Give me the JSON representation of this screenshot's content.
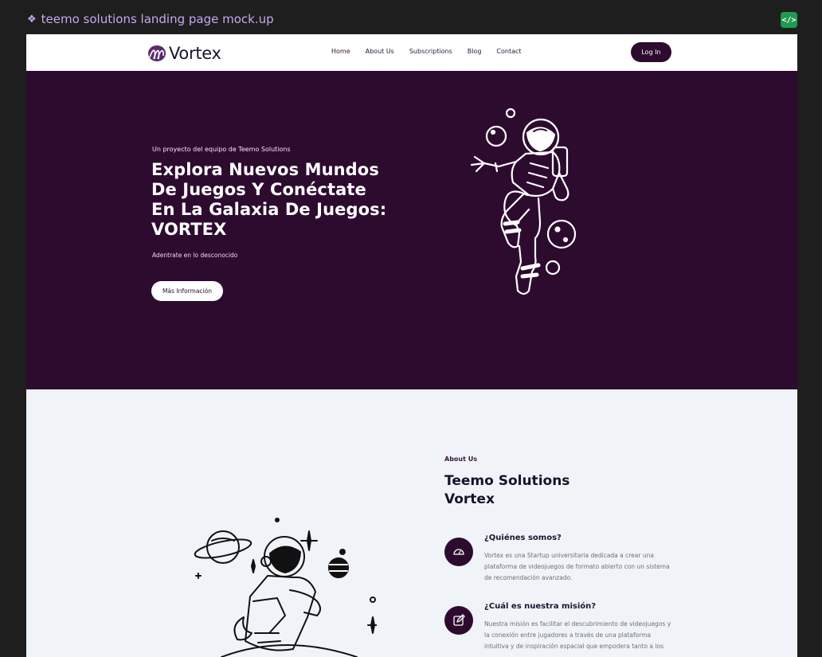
{
  "editor": {
    "frame_title": "teemo solutions landing page mock.up",
    "frame_icon": "component-diamond-icon",
    "code_button_label": "</>"
  },
  "nav": {
    "logo_text": "Vortex",
    "logo_icon": "vortex-logo-icon",
    "links": [
      "Home",
      "About Us",
      "Subscriptions",
      "Blog",
      "Contact"
    ],
    "login_label": "Log In"
  },
  "hero": {
    "eyebrow": "Un proyecto del equipo de Teemo Solutions",
    "title": "Explora Nuevos Mundos De Juegos Y Conéctate En La Galaxia De Juegos: VORTEX",
    "subtitle": "Adentrate en lo desconocido",
    "cta_label": "Más Información",
    "illustration": "floating-astronaut-illustration"
  },
  "about": {
    "eyebrow": "About Us",
    "title_line1": "Teemo Solutions",
    "title_line2": "Vortex",
    "illustration": "astronaut-on-planet-illustration",
    "features": [
      {
        "icon": "speedometer-icon",
        "heading": "¿Quiénes somos?",
        "text": "Vortex es una Startup universitaria dedicada a crear una plataforma de videojuegos de formato abierto con un sistema de recomendación avanzado."
      },
      {
        "icon": "edit-icon",
        "heading": "¿Cuál es nuestra misión?",
        "text": "Nuestra misión es facilitar el descubrimiento de videojuegos y la conexión entre jugadores a través de una plataforma intuitiva y de inspiración espacial que empodera tanto a los"
      }
    ]
  },
  "colors": {
    "brand_purple": "#2d0b2f",
    "section_bg": "#f0f4f8",
    "canvas_bg": "#1e1e1e",
    "frame_label": "#c9a7f2",
    "code_button": "#1f9a4f"
  }
}
